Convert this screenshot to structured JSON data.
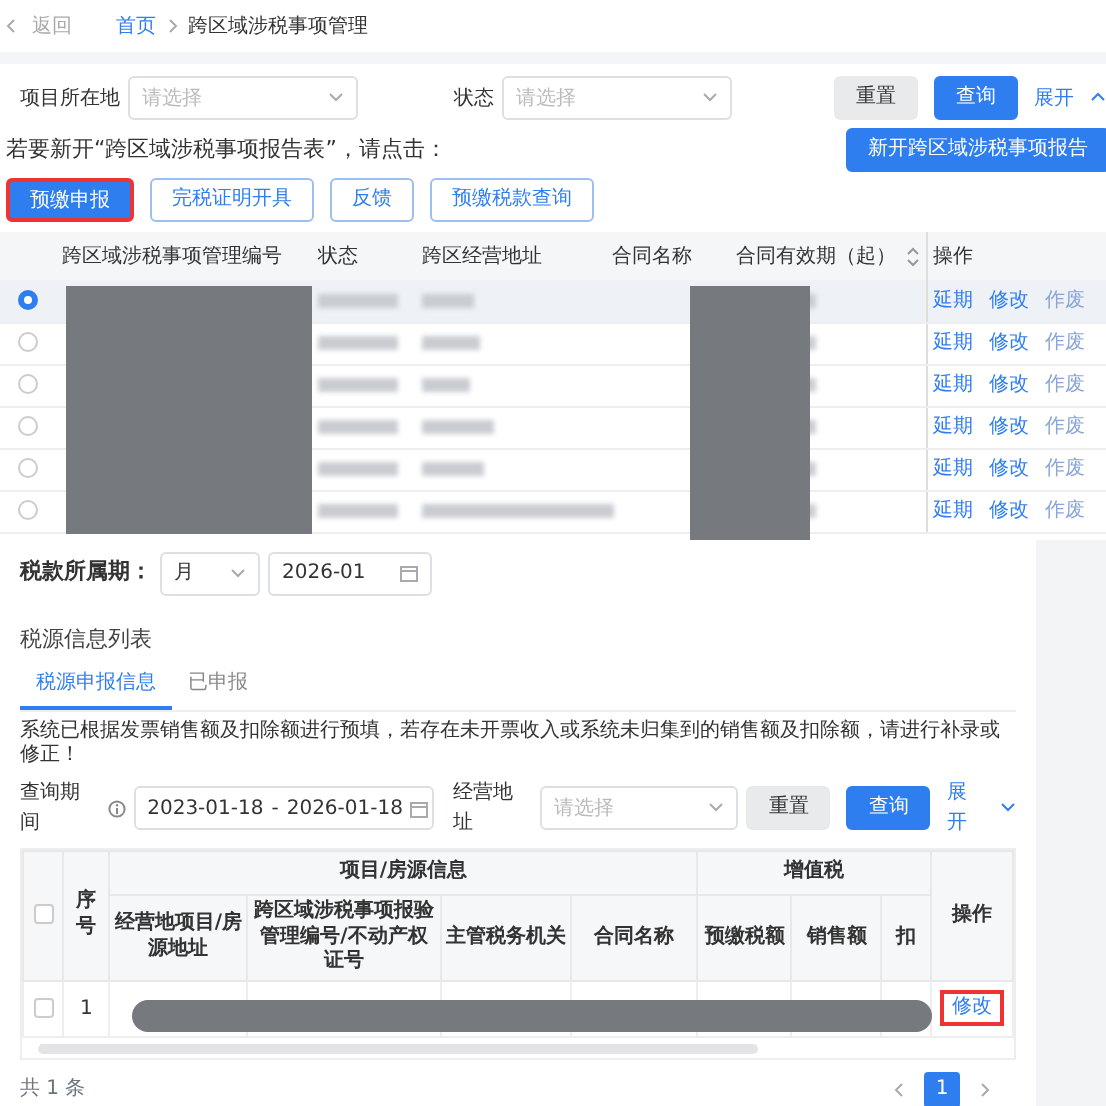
{
  "header": {
    "back": "返回",
    "breadcrumb": [
      {
        "label": "首页",
        "kind": "link"
      },
      {
        "label": "跨区域涉税事项管理",
        "kind": "current"
      }
    ]
  },
  "filters": [
    {
      "label": "项目所在地",
      "placeholder": "请选择"
    },
    {
      "label": "状态",
      "placeholder": "请选择"
    }
  ],
  "filter_buttons": [
    {
      "label": "重置",
      "kind": "secondary"
    },
    {
      "label": "查询",
      "kind": "primary"
    }
  ],
  "expand": "展开",
  "prompt": "若要新开“跨区域涉税事项报告表”，请点击：",
  "new_button": "新开跨区域涉税事项报告",
  "actions": [
    {
      "label": "预缴申报",
      "kind": "primary",
      "highlighted": true
    },
    {
      "label": "完税证明开具",
      "kind": "outline",
      "highlighted": false
    },
    {
      "label": "反馈",
      "kind": "outline",
      "highlighted": false
    },
    {
      "label": "预缴税款查询",
      "kind": "outline",
      "highlighted": false
    }
  ],
  "table": {
    "columns": [
      "跨区域涉税事项管理编号",
      "状态",
      "跨区经营地址",
      "合同名称",
      "合同有效期（起）",
      "操作"
    ],
    "rows": [
      {
        "selected": true,
        "actions": [
          {
            "label": "延期",
            "disabled": false
          },
          {
            "label": "修改",
            "disabled": false
          },
          {
            "label": "作废",
            "disabled": true
          }
        ]
      },
      {
        "selected": false,
        "actions": [
          {
            "label": "延期",
            "disabled": false
          },
          {
            "label": "修改",
            "disabled": false
          },
          {
            "label": "作废",
            "disabled": true
          }
        ]
      },
      {
        "selected": false,
        "actions": [
          {
            "label": "延期",
            "disabled": false
          },
          {
            "label": "修改",
            "disabled": false
          },
          {
            "label": "作废",
            "disabled": true
          }
        ]
      },
      {
        "selected": false,
        "actions": [
          {
            "label": "延期",
            "disabled": false
          },
          {
            "label": "修改",
            "disabled": false
          },
          {
            "label": "作废",
            "disabled": true
          }
        ]
      },
      {
        "selected": false,
        "actions": [
          {
            "label": "延期",
            "disabled": false
          },
          {
            "label": "修改",
            "disabled": false
          },
          {
            "label": "作废",
            "disabled": true
          }
        ]
      },
      {
        "selected": false,
        "actions": [
          {
            "label": "延期",
            "disabled": false
          },
          {
            "label": "修改",
            "disabled": false
          },
          {
            "label": "作废",
            "disabled": true
          }
        ]
      }
    ]
  },
  "period": {
    "label": "税款所属期：",
    "unit": "月",
    "value": "2026-01"
  },
  "tax_source": {
    "title": "税源信息列表",
    "tabs": [
      {
        "label": "税源申报信息",
        "selected": true
      },
      {
        "label": "已申报",
        "selected": false
      }
    ],
    "notice": "系统已根据发票销售额及扣除额进行预填，若存在未开票收入或系统未归集到的销售额及扣除额，请进行补录或修正！",
    "filters": {
      "period_label": "查询期间",
      "start": "2023-01-18",
      "separator": "-",
      "end": "2026-01-18",
      "address_label": "经营地址",
      "address_placeholder": "请选择"
    },
    "buttons": [
      {
        "label": "重置",
        "kind": "secondary"
      },
      {
        "label": "查询",
        "kind": "primary"
      }
    ],
    "expand": "展开",
    "table": {
      "all_checked": false,
      "number_header": "序号",
      "action_header": "操作",
      "groups": [
        {
          "label": "项目/房源信息",
          "columns": [
            "经营地项目/房源地址",
            "跨区域涉税事项报验管理编号/不动产权证号",
            "主管税务机关",
            "合同名称"
          ]
        },
        {
          "label": "增值税",
          "columns": [
            "预缴税额",
            "销售额",
            "扣"
          ]
        }
      ],
      "rows": [
        {
          "number": "1",
          "checked": false,
          "actions": [
            {
              "label": "修改",
              "highlighted": true
            }
          ]
        }
      ]
    },
    "total": "共 1 条",
    "pages": [
      {
        "label": "1",
        "selected": true
      }
    ]
  }
}
